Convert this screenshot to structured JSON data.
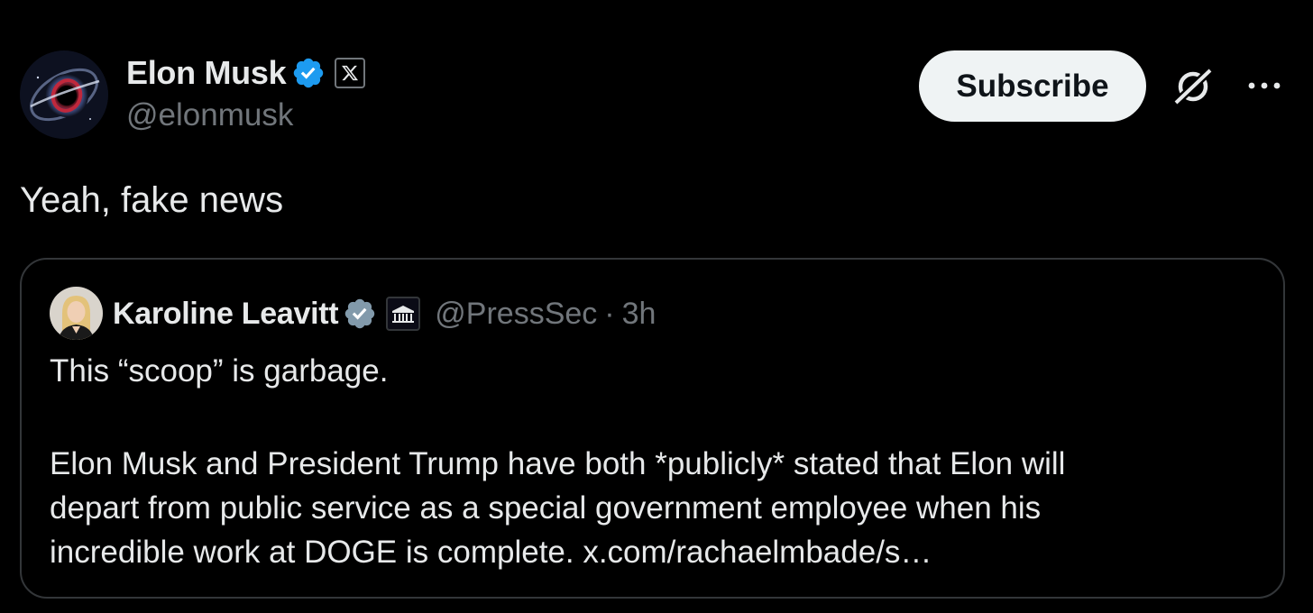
{
  "colors": {
    "background": "#000000",
    "text_primary": "#e7e9ea",
    "text_secondary": "#71767b",
    "verified_blue": "#1d9bf0",
    "verified_gray": "#829aab",
    "border": "#333639",
    "subscribe_bg": "#eff3f4"
  },
  "post": {
    "author": {
      "display_name": "Elon Musk",
      "handle": "@elonmusk",
      "avatar_icon": "black-hole-avatar",
      "verified_icon": "verified-badge-icon",
      "affiliation_icon": "x-logo-icon"
    },
    "actions": {
      "subscribe_label": "Subscribe",
      "grok_icon": "grok-icon",
      "more_icon": "more-options-icon"
    },
    "text": "Yeah, fake news"
  },
  "quote": {
    "author": {
      "display_name": "Karoline Leavitt",
      "handle": "@PressSec",
      "separator": "·",
      "time": "3h",
      "verified_icon": "gray-verified-badge-icon",
      "affiliation_icon": "white-house-icon"
    },
    "text_line1": "This “scoop” is garbage.",
    "text_lines": [
      "Elon Musk and President Trump have both *publicly* stated that Elon will",
      "depart from public service as a special government employee when his",
      "incredible work at DOGE is complete. x.com/rachaelmbade/s…"
    ]
  }
}
